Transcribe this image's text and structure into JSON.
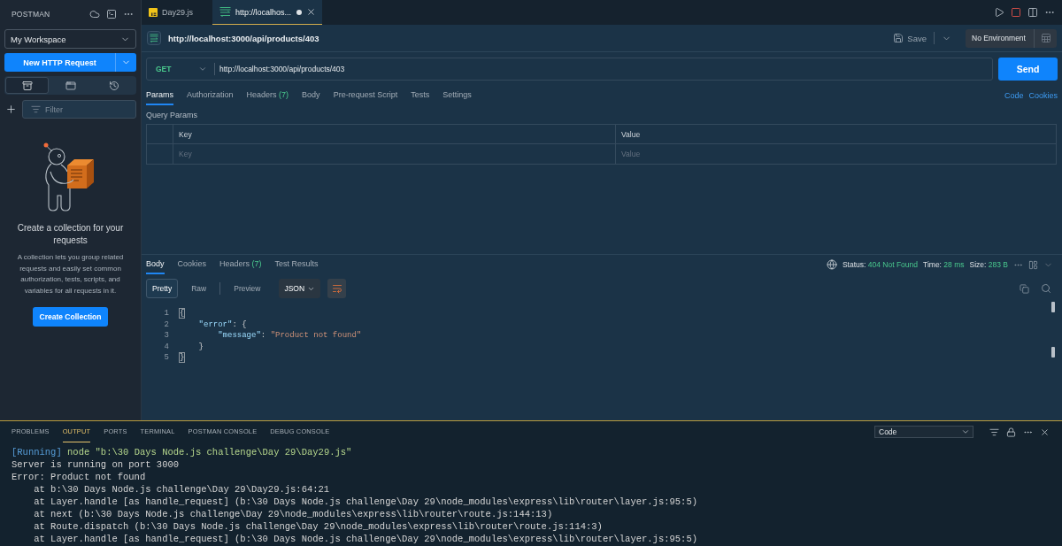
{
  "sidebar": {
    "title": "POSTMAN",
    "workspace": "My Workspace",
    "new_request": "New HTTP Request",
    "views": [
      {
        "kind": "collections",
        "selected": true
      },
      {
        "kind": "environments",
        "selected": false
      },
      {
        "kind": "history",
        "selected": false
      }
    ],
    "filter": {
      "placeholder": "Filter"
    },
    "empty_state": {
      "heading": "Create a collection for your requests",
      "description": "A collection lets you group related requests and easily set common authorization, tests, scripts, and variables for all requests in it.",
      "button": "Create Collection"
    }
  },
  "editor_tabs": [
    {
      "kind": "script",
      "label": "Day29.js",
      "selected": false,
      "unsaved": false
    },
    {
      "kind": "request",
      "label": "http://localhos...",
      "selected": true,
      "unsaved": true
    }
  ],
  "request": {
    "title": "http://localhost:3000/api/products/403",
    "save": "Save",
    "environment": "No Environment",
    "method": "GET",
    "url": "http://localhost:3000/api/products/403",
    "send": "Send",
    "tabs": [
      {
        "label": "Params",
        "selected": true
      },
      {
        "label": "Authorization",
        "selected": false
      },
      {
        "label": "Headers",
        "count": "(7)",
        "selected": false
      },
      {
        "label": "Body",
        "selected": false
      },
      {
        "label": "Pre-request Script",
        "selected": false
      },
      {
        "label": "Tests",
        "selected": false
      },
      {
        "label": "Settings",
        "selected": false
      }
    ],
    "links": [
      "Code",
      "Cookies"
    ],
    "query_params": {
      "title": "Query Params",
      "columns": [
        "Key",
        "Value"
      ],
      "new_row": {
        "key": {
          "placeholder": "Key"
        },
        "value": {
          "placeholder": "Value"
        }
      }
    }
  },
  "response": {
    "tabs": [
      {
        "label": "Body",
        "selected": true
      },
      {
        "label": "Cookies",
        "selected": false
      },
      {
        "label": "Headers",
        "count": "(7)",
        "selected": false
      },
      {
        "label": "Test Results",
        "selected": false
      }
    ],
    "status": {
      "label": "Status:",
      "value": "404 Not Found"
    },
    "time": {
      "label": "Time:",
      "value": "28 ms"
    },
    "size": {
      "label": "Size:",
      "value": "283 B"
    },
    "view_modes": [
      {
        "label": "Pretty",
        "selected": true
      },
      {
        "label": "Raw",
        "selected": false
      },
      {
        "label": "Preview",
        "selected": false
      }
    ],
    "format": "JSON",
    "body": [
      {
        "number": "1",
        "tokens": [
          {
            "kind": "brace_match",
            "text": "{"
          }
        ]
      },
      {
        "number": "2",
        "tokens": [
          {
            "kind": "key",
            "text": "    \"error\""
          },
          {
            "kind": "punct",
            "text": ": {"
          }
        ]
      },
      {
        "number": "3",
        "tokens": [
          {
            "kind": "key",
            "text": "        \"message\""
          },
          {
            "kind": "punct",
            "text": ": "
          },
          {
            "kind": "string",
            "text": "\"Product not found\""
          }
        ]
      },
      {
        "number": "4",
        "tokens": [
          {
            "kind": "punct",
            "text": "    }"
          }
        ]
      },
      {
        "number": "5",
        "tokens": [
          {
            "kind": "brace_match",
            "text": "}"
          }
        ]
      }
    ]
  },
  "panel": {
    "tabs": [
      {
        "label": "PROBLEMS",
        "selected": false
      },
      {
        "label": "OUTPUT",
        "selected": true
      },
      {
        "label": "PORTS",
        "selected": false
      },
      {
        "label": "TERMINAL",
        "selected": false
      },
      {
        "label": "POSTMAN CONSOLE",
        "selected": false
      },
      {
        "label": "DEBUG CONSOLE",
        "selected": false
      }
    ],
    "channel": "Code",
    "output": [
      {
        "kind": "run",
        "tag": "[Running]",
        "text": "node \"b:\\30 Days Node.js challenge\\Day 29\\Day29.js\""
      },
      {
        "kind": "plain",
        "text": "Server is running on port 3000"
      },
      {
        "kind": "plain",
        "text": "Error: Product not found"
      },
      {
        "kind": "plain",
        "text": "    at b:\\30 Days Node.js challenge\\Day 29\\Day29.js:64:21"
      },
      {
        "kind": "plain",
        "text": "    at Layer.handle [as handle_request] (b:\\30 Days Node.js challenge\\Day 29\\node_modules\\express\\lib\\router\\layer.js:95:5)"
      },
      {
        "kind": "plain",
        "text": "    at next (b:\\30 Days Node.js challenge\\Day 29\\node_modules\\express\\lib\\router\\route.js:144:13)"
      },
      {
        "kind": "plain",
        "text": "    at Route.dispatch (b:\\30 Days Node.js challenge\\Day 29\\node_modules\\express\\lib\\router\\route.js:114:3)"
      },
      {
        "kind": "plain",
        "text": "    at Layer.handle [as handle_request] (b:\\30 Days Node.js challenge\\Day 29\\node_modules\\express\\lib\\router\\layer.js:95:5)"
      }
    ]
  }
}
